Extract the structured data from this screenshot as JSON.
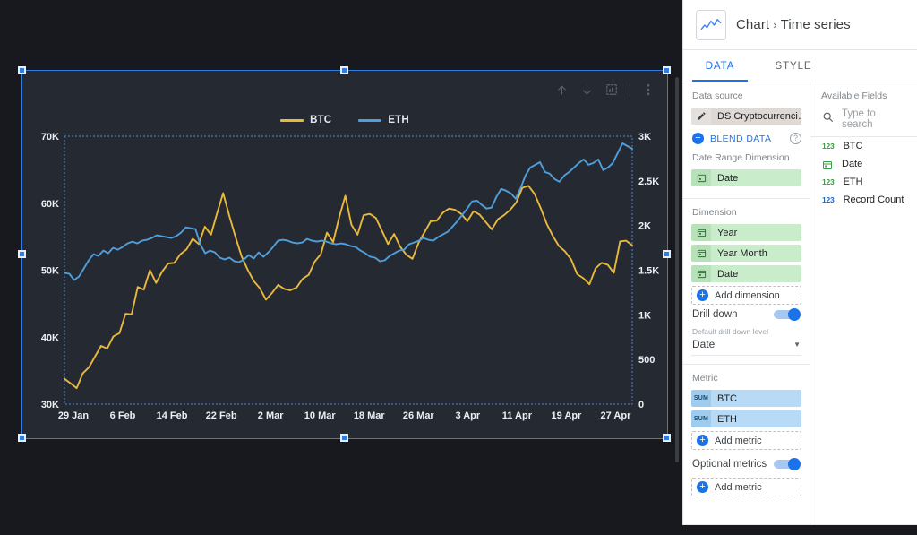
{
  "panel": {
    "header": {
      "chart_icon": "line-chart-icon",
      "title": "Chart",
      "separator": "›",
      "subtitle": "Time series"
    },
    "tabs": [
      {
        "label": "DATA",
        "active": true
      },
      {
        "label": "STYLE",
        "active": false
      }
    ],
    "data_source": {
      "label": "Data source",
      "edit_icon": "pencil-icon",
      "name": "DS Cryptocurrenci…",
      "blend_icon": "plus-circle-icon",
      "blend_label": "BLEND DATA",
      "help_icon": "question-mark-icon"
    },
    "date_range_dimension": {
      "label": "Date Range Dimension",
      "chips": [
        {
          "icon": "calendar-icon",
          "name": "Date"
        }
      ]
    },
    "dimension": {
      "label": "Dimension",
      "chips": [
        {
          "icon": "calendar-icon",
          "name": "Year"
        },
        {
          "icon": "calendar-icon",
          "name": "Year Month"
        },
        {
          "icon": "calendar-icon",
          "name": "Date"
        }
      ],
      "add_label": "Add dimension",
      "add_icon": "plus-circle-icon"
    },
    "drill_down": {
      "label": "Drill down",
      "enabled": true,
      "sub_label": "Default drill down level",
      "selected_level": "Date",
      "caret_icon": "chevron-down-icon"
    },
    "metric": {
      "label": "Metric",
      "chips": [
        {
          "agg": "SUM",
          "name": "BTC"
        },
        {
          "agg": "SUM",
          "name": "ETH"
        }
      ],
      "add_label": "Add metric",
      "add_icon": "plus-circle-icon"
    },
    "optional_metrics": {
      "label": "Optional metrics",
      "enabled": true,
      "add_label": "Add metric",
      "add_icon": "plus-circle-icon"
    },
    "available_fields": {
      "label": "Available Fields",
      "search_icon": "search-icon",
      "search_value": "",
      "search_placeholder": "Type to search",
      "fields": [
        {
          "type": "123",
          "type_color": "green",
          "name": "BTC"
        },
        {
          "type": "cal",
          "type_color": "green",
          "name": "Date"
        },
        {
          "type": "123",
          "type_color": "green",
          "name": "ETH"
        },
        {
          "type": "123",
          "type_color": "blue",
          "name": "Record Count"
        }
      ]
    }
  },
  "chart_toolbar": {
    "buttons": [
      {
        "icon": "arrow-up-icon",
        "glyph": "↑"
      },
      {
        "icon": "arrow-down-icon",
        "glyph": "↓"
      },
      {
        "icon": "chart-type-icon",
        "glyph": ""
      },
      {
        "icon": "more-vert-icon",
        "glyph": "⋮"
      }
    ]
  },
  "colors": {
    "btc": "#e8b93c",
    "eth": "#4f9fdd",
    "canvas_bg": "#17191f",
    "chart_bg": "#252932",
    "selection": "#2f7de1",
    "accent": "#1a73e8",
    "axis_text": "#eceff4"
  },
  "chart_data": {
    "type": "line",
    "title": "",
    "xlabel": "",
    "ylabel": "",
    "grid": false,
    "legend_position": "top-center",
    "x_tick_labels": [
      "29 Jan",
      "6 Feb",
      "14 Feb",
      "22 Feb",
      "2 Mar",
      "10 Mar",
      "18 Mar",
      "26 Mar",
      "3 Apr",
      "11 Apr",
      "19 Apr",
      "27 Apr"
    ],
    "left_axis": {
      "name": "BTC",
      "tick_labels": [
        "30K",
        "40K",
        "50K",
        "60K",
        "70K"
      ],
      "ticks": [
        30000,
        40000,
        50000,
        60000,
        70000
      ],
      "ylim": [
        30000,
        70000
      ]
    },
    "right_axis": {
      "name": "ETH",
      "tick_labels": [
        "0",
        "500",
        "1K",
        "1.5K",
        "2K",
        "2.5K",
        "3K"
      ],
      "ticks": [
        0,
        500,
        1000,
        1500,
        2000,
        2500,
        3000
      ],
      "ylim": [
        0,
        3000
      ]
    },
    "series": [
      {
        "name": "BTC",
        "color": "#e8b93c",
        "axis": "left",
        "values": [
          33800,
          33100,
          32400,
          34600,
          35500,
          37100,
          38700,
          38300,
          40100,
          40600,
          43500,
          43400,
          47500,
          47100,
          50000,
          48100,
          49800,
          51000,
          51100,
          52400,
          53100,
          54700,
          53900,
          56500,
          55300,
          58500,
          61500,
          58100,
          55000,
          52100,
          50100,
          48400,
          47300,
          45600,
          46600,
          47800,
          47200,
          47000,
          47400,
          48700,
          49300,
          51300,
          52400,
          55600,
          54200,
          57900,
          61100,
          56800,
          55300,
          58200,
          58400,
          57800,
          55900,
          53900,
          55400,
          53500,
          52300,
          51700,
          54100,
          55700,
          57300,
          57400,
          58600,
          59200,
          59000,
          58400,
          57300,
          58800,
          58300,
          57200,
          56100,
          57600,
          58200,
          59000,
          60100,
          62300,
          62600,
          61400,
          59300,
          56900,
          55100,
          53600,
          52800,
          51600,
          49400,
          48800,
          47900,
          50300,
          51100,
          50800,
          49600,
          54300,
          54400,
          53700
        ]
      },
      {
        "name": "ETH",
        "color": "#4f9fdd",
        "axis": "right",
        "values": [
          1470,
          1460,
          1390,
          1430,
          1520,
          1610,
          1680,
          1660,
          1720,
          1690,
          1750,
          1730,
          1760,
          1800,
          1820,
          1800,
          1830,
          1840,
          1860,
          1890,
          1880,
          1870,
          1860,
          1880,
          1920,
          1980,
          1970,
          1960,
          1790,
          1690,
          1720,
          1700,
          1640,
          1620,
          1640,
          1600,
          1590,
          1620,
          1670,
          1630,
          1700,
          1650,
          1700,
          1760,
          1830,
          1840,
          1830,
          1810,
          1800,
          1810,
          1850,
          1830,
          1820,
          1830,
          1820,
          1800,
          1790,
          1800,
          1790,
          1770,
          1760,
          1720,
          1690,
          1650,
          1640,
          1600,
          1610,
          1660,
          1690,
          1720,
          1730,
          1790,
          1810,
          1830,
          1860,
          1840,
          1830,
          1870,
          1900,
          1930,
          1990,
          2050,
          2120,
          2190,
          2270,
          2280,
          2230,
          2190,
          2200,
          2320,
          2410,
          2390,
          2360,
          2300,
          2420,
          2560,
          2650,
          2680,
          2710,
          2600,
          2580,
          2520,
          2490,
          2560,
          2600,
          2650,
          2700,
          2740,
          2680,
          2700,
          2740,
          2620,
          2650,
          2700,
          2810,
          2920,
          2890,
          2860
        ]
      }
    ]
  }
}
